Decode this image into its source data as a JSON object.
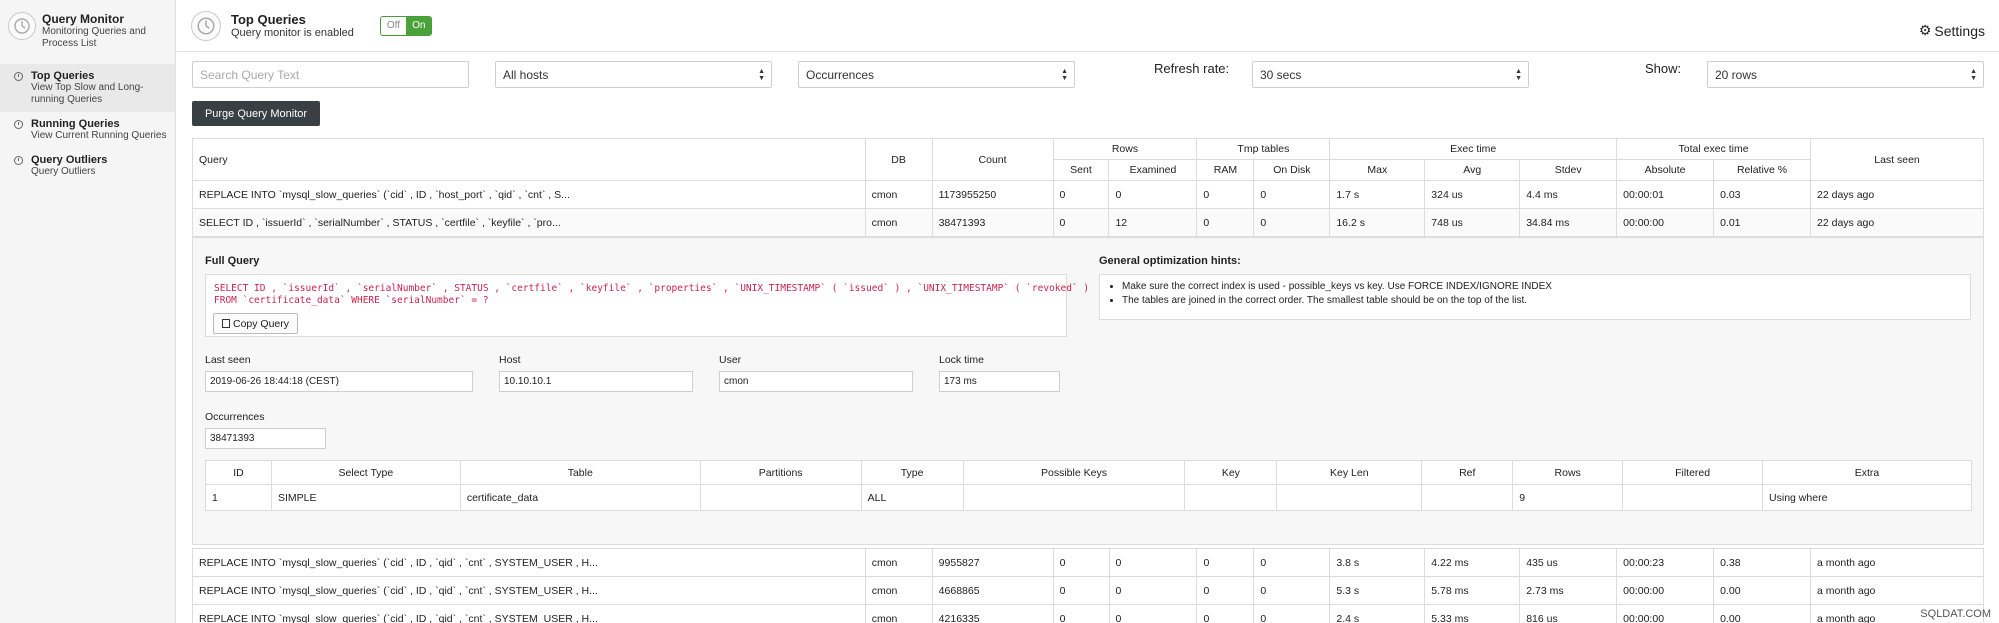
{
  "sidebar": {
    "app_title": "Query Monitor",
    "app_subtitle": "Monitoring Queries and Process List",
    "items": [
      {
        "label": "Top Queries",
        "desc": "View Top Slow and Long-running Queries"
      },
      {
        "label": "Running Queries",
        "desc": "View Current Running Queries"
      },
      {
        "label": "Query Outliers",
        "desc": "Query Outliers"
      }
    ]
  },
  "header": {
    "title": "Top Queries",
    "subtitle": "Query monitor is enabled",
    "toggle_off": "Off",
    "toggle_on": "On",
    "settings_label": "Settings",
    "settings_icon": "gear-icon"
  },
  "filters": {
    "search_placeholder": "Search Query Text",
    "hosts": "All hosts",
    "sort": "Occurrences",
    "refresh_label": "Refresh rate:",
    "refresh_value": "30 secs",
    "show_label": "Show:",
    "show_value": "20 rows"
  },
  "purge_label": "Purge Query Monitor",
  "table": {
    "h_query": "Query",
    "h_db": "DB",
    "h_count": "Count",
    "h_rows": "Rows",
    "h_tmp": "Tmp tables",
    "h_exec": "Exec time",
    "h_total": "Total exec time",
    "h_last": "Last seen",
    "h_sent": "Sent",
    "h_examined": "Examined",
    "h_ram": "RAM",
    "h_disk": "On Disk",
    "h_max": "Max",
    "h_avg": "Avg",
    "h_stdev": "Stdev",
    "h_abs": "Absolute",
    "h_rel": "Relative %",
    "rows": [
      {
        "query": "REPLACE INTO `mysql_slow_queries` (`cid` , ID , `host_port` , `qid` , `cnt` , S...",
        "db": "cmon",
        "count": "1173955250",
        "sent": "0",
        "examined": "0",
        "ram": "0",
        "disk": "0",
        "max": "1.7 s",
        "avg": "324 us",
        "stdev": "4.4 ms",
        "abs": "00:00:01",
        "rel": "0.03",
        "last": "22 days ago"
      },
      {
        "query": "SELECT ID , `issuerId` , `serialNumber` , STATUS , `certfile` , `keyfile` , `pro...",
        "db": "cmon",
        "count": "38471393",
        "sent": "0",
        "examined": "12",
        "ram": "0",
        "disk": "0",
        "max": "16.2 s",
        "avg": "748 us",
        "stdev": "34.84 ms",
        "abs": "00:00:00",
        "rel": "0.01",
        "last": "22 days ago"
      },
      {
        "query": "REPLACE INTO `mysql_slow_queries` (`cid` , ID , `qid` , `cnt` , SYSTEM_USER , H...",
        "db": "cmon",
        "count": "9955827",
        "sent": "0",
        "examined": "0",
        "ram": "0",
        "disk": "0",
        "max": "3.8 s",
        "avg": "4.22 ms",
        "stdev": "435 us",
        "abs": "00:00:23",
        "rel": "0.38",
        "last": "a month ago"
      },
      {
        "query": "REPLACE INTO `mysql_slow_queries` (`cid` , ID , `qid` , `cnt` , SYSTEM_USER , H...",
        "db": "cmon",
        "count": "4668865",
        "sent": "0",
        "examined": "0",
        "ram": "0",
        "disk": "0",
        "max": "5.3 s",
        "avg": "5.78 ms",
        "stdev": "2.73 ms",
        "abs": "00:00:00",
        "rel": "0.00",
        "last": "a month ago"
      },
      {
        "query": "REPLACE INTO `mysql_slow_queries` (`cid` , ID , `qid` , `cnt` , SYSTEM_USER , H...",
        "db": "cmon",
        "count": "4216335",
        "sent": "0",
        "examined": "0",
        "ram": "0",
        "disk": "0",
        "max": "2.4 s",
        "avg": "5.33 ms",
        "stdev": "816 us",
        "abs": "00:00:00",
        "rel": "0.00",
        "last": "a month ago"
      }
    ]
  },
  "detail": {
    "full_query_label": "Full Query",
    "sql_line1": "SELECT ID , `issuerId` , `serialNumber` , STATUS , `certfile` , `keyfile` , `properties` , `UNIX_TIMESTAMP` ( `issued` ) , `UNIX_TIMESTAMP` ( `revoked` )",
    "sql_line2": "FROM `certificate_data` WHERE `serialNumber` = ?",
    "copy_label": "Copy Query",
    "hints_label": "General optimization hints:",
    "hints": [
      "Make sure the correct index is used - possible_keys vs key. Use FORCE INDEX/IGNORE INDEX",
      "The tables are joined in the correct order. The smallest table should be on the top of the list."
    ],
    "last_seen_label": "Last seen",
    "last_seen_value": "2019-06-26 18:44:18 (CEST)",
    "host_label": "Host",
    "host_value": "10.10.10.1",
    "user_label": "User",
    "user_value": "cmon",
    "lock_label": "Lock time",
    "lock_value": "173 ms",
    "occ_label": "Occurrences",
    "occ_value": "38471393",
    "explain": {
      "headers": [
        "ID",
        "Select Type",
        "Table",
        "Partitions",
        "Type",
        "Possible Keys",
        "Key",
        "Key Len",
        "Ref",
        "Rows",
        "Filtered",
        "Extra"
      ],
      "row": [
        "1",
        "SIMPLE",
        "certificate_data",
        "",
        "ALL",
        "",
        "",
        "",
        "",
        "9",
        "",
        "Using where"
      ]
    }
  },
  "watermark": "SQLDAT.COM"
}
